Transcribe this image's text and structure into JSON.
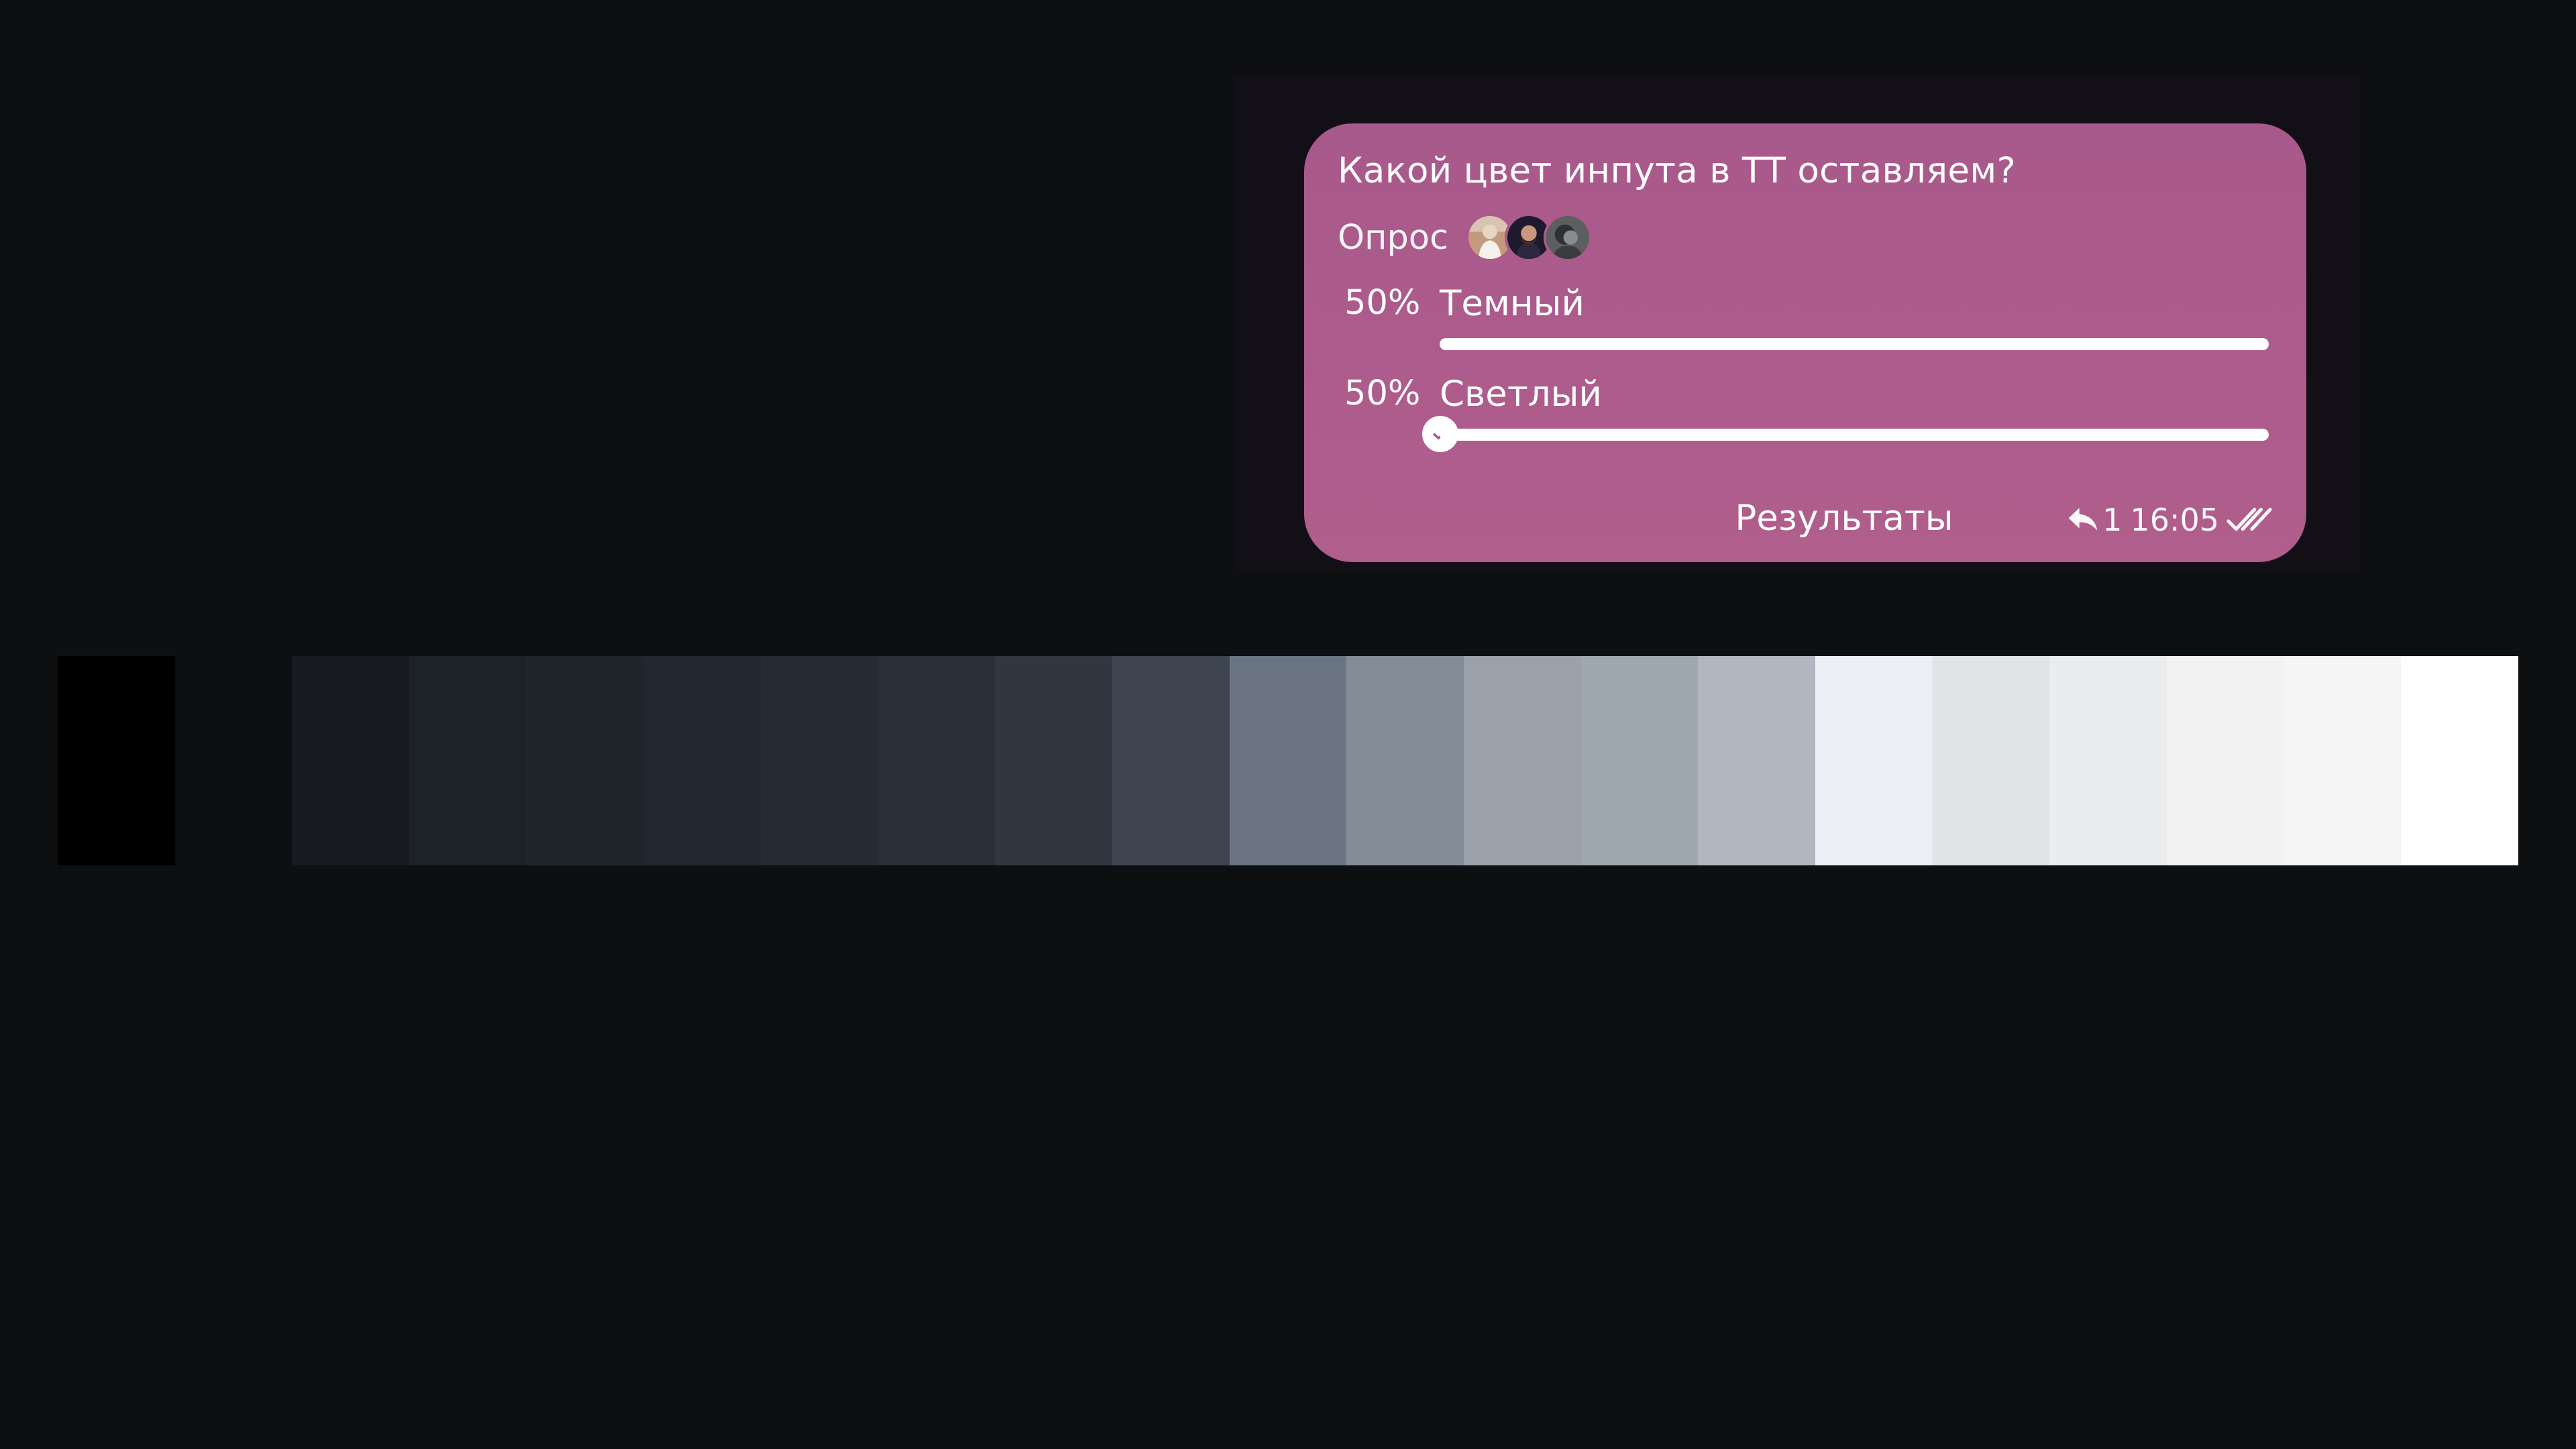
{
  "poll": {
    "question": "Какой цвет инпута в ТТ оставляем?",
    "type_label": "Опрос",
    "voters": [
      {
        "avatar": "voter-1-avatar"
      },
      {
        "avatar": "voter-2-avatar"
      },
      {
        "avatar": "voter-3-avatar"
      }
    ],
    "options": [
      {
        "percent_text": "50%",
        "label": "Темный",
        "share": 0.5,
        "selected": false
      },
      {
        "percent_text": "50%",
        "label": "Светлый",
        "share": 0.5,
        "selected": true
      }
    ],
    "results_label": "Результаты",
    "reply_count": "1",
    "time": "16:05",
    "status": "read",
    "bubble_color": "#ab5a8b"
  },
  "palette": {
    "swatches": [
      "#000000",
      "#0b0f12",
      "#171b21",
      "#1d2128",
      "#20242b",
      "#23272f",
      "#262a32",
      "#2a2e38",
      "#313640",
      "#3e4550",
      "#6a7581",
      "#838d98",
      "#9aa1aa",
      "#9fa8b1",
      "#b1b6c0",
      "#ebeff5",
      "#e2e3e5",
      "#ebecee",
      "#f2f2f3",
      "#f5f5f5",
      "#ffffff"
    ]
  }
}
